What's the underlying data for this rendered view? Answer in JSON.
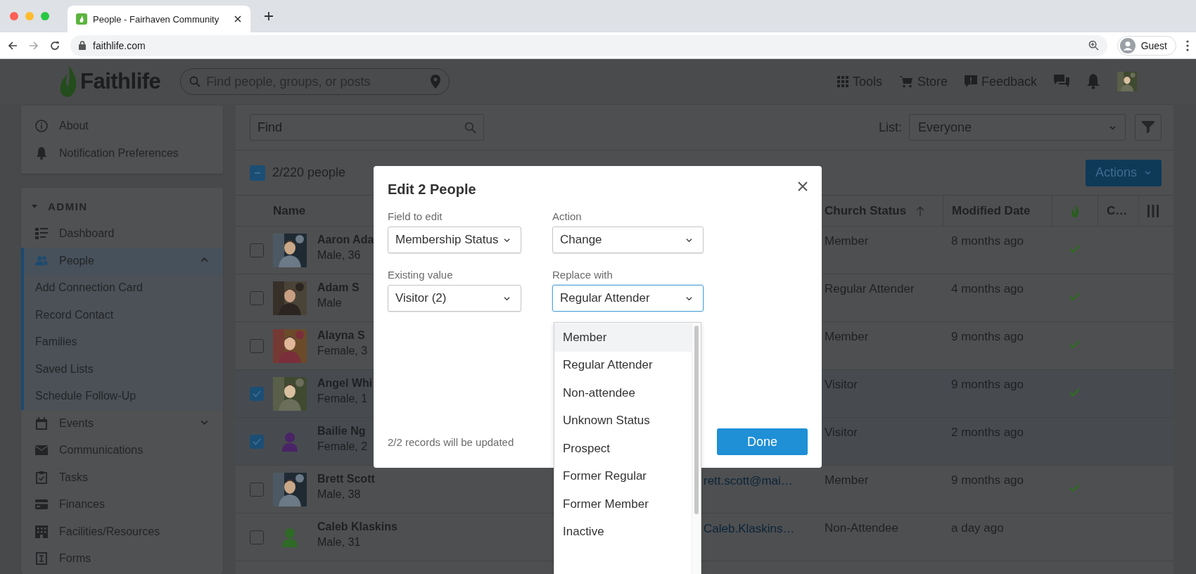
{
  "browser": {
    "tab_title": "People - Fairhaven Community",
    "url": "faithlife.com",
    "profile": "Guest"
  },
  "header": {
    "logo": "Faithlife",
    "search_placeholder": "Find people, groups, or posts",
    "nav": [
      "Tools",
      "Store",
      "Feedback"
    ]
  },
  "sidebar": {
    "top_items": [
      {
        "label": "About"
      },
      {
        "label": "Notification Preferences"
      }
    ],
    "section": {
      "title": "ADMIN",
      "expanded": true
    },
    "items": [
      {
        "label": "Dashboard",
        "selected": false
      },
      {
        "label": "People",
        "selected": true,
        "expanded": true,
        "children": [
          {
            "label": "Add Connection Card"
          },
          {
            "label": "Record Contact"
          },
          {
            "label": "Families"
          },
          {
            "label": "Saved Lists"
          },
          {
            "label": "Schedule Follow-Up"
          }
        ]
      },
      {
        "label": "Events",
        "selected": false,
        "expanded": false
      },
      {
        "label": "Communications",
        "selected": false
      },
      {
        "label": "Tasks",
        "selected": false
      },
      {
        "label": "Finances",
        "selected": false
      },
      {
        "label": "Facilities/Resources",
        "selected": false
      },
      {
        "label": "Forms",
        "selected": false
      }
    ]
  },
  "toolbar": {
    "find_placeholder": "Find",
    "list_label": "List:",
    "list_value": "Everyone",
    "partially_selected": true,
    "selection_label": "2/220 people",
    "actions": "Actions"
  },
  "table": {
    "columns": [
      {
        "label": "Name",
        "sorted": false
      },
      {
        "label": "Church Status",
        "sorted": true
      },
      {
        "label": "Modified Date",
        "sorted": false
      },
      {
        "label": "C…",
        "sorted": false
      }
    ],
    "rows": [
      {
        "name": "Aaron Ada",
        "detail": "Male, 36",
        "selected": false,
        "church_status": "Member",
        "modified": "8 months ago",
        "synced": true
      },
      {
        "name": "Adam S",
        "detail": "Male",
        "selected": false,
        "church_status": "Regular Attender",
        "modified": "4 months ago",
        "synced": true
      },
      {
        "name": "Alayna S",
        "detail": "Female, 3",
        "selected": false,
        "church_status": "Member",
        "modified": "9 months ago",
        "synced": true
      },
      {
        "name": "Angel Whi",
        "detail": "Female, 1",
        "selected": true,
        "church_status": "Visitor",
        "modified": "9 months ago",
        "synced": true
      },
      {
        "name": "Bailie Ng",
        "detail": "Female, 2",
        "selected": true,
        "avatar": {
          "kind": "silhouette",
          "color": "#4a2466"
        },
        "church_status": "Visitor",
        "modified": "2 months ago",
        "synced": false
      },
      {
        "name": "Brett Scott",
        "detail": "Male, 38",
        "selected": false,
        "email": "rett.scott@mai…",
        "church_status": "Member",
        "modified": "9 months ago",
        "synced": true
      },
      {
        "name": "Caleb Klaskins",
        "detail": "Male, 31",
        "selected": false,
        "avatar": {
          "kind": "silhouette",
          "color": "#2f6a26"
        },
        "email": "Caleb.Klaskins…",
        "church_status": "Non-Attendee",
        "modified": "a day ago",
        "synced": false
      }
    ]
  },
  "dialog": {
    "title": "Edit 2 People",
    "fields": [
      {
        "label": "Field to edit",
        "value": "Membership Status",
        "focused": false
      },
      {
        "label": "Action",
        "value": "Change",
        "focused": false
      },
      {
        "label": "Existing value",
        "value": "Visitor (2)",
        "focused": false
      },
      {
        "label": "Replace with",
        "value": "Regular Attender",
        "focused": true
      }
    ],
    "footer": "2/2 records will be updated",
    "done": "Done",
    "options": [
      {
        "label": "Member",
        "highlighted": true
      },
      {
        "label": "Regular Attender",
        "highlighted": false
      },
      {
        "label": "Non-attendee",
        "highlighted": false
      },
      {
        "label": "Unknown Status",
        "highlighted": false
      },
      {
        "label": "Prospect",
        "highlighted": false
      },
      {
        "label": "Former Regular",
        "highlighted": false
      },
      {
        "label": "Former Member",
        "highlighted": false
      },
      {
        "label": "Inactive",
        "highlighted": false
      }
    ]
  }
}
